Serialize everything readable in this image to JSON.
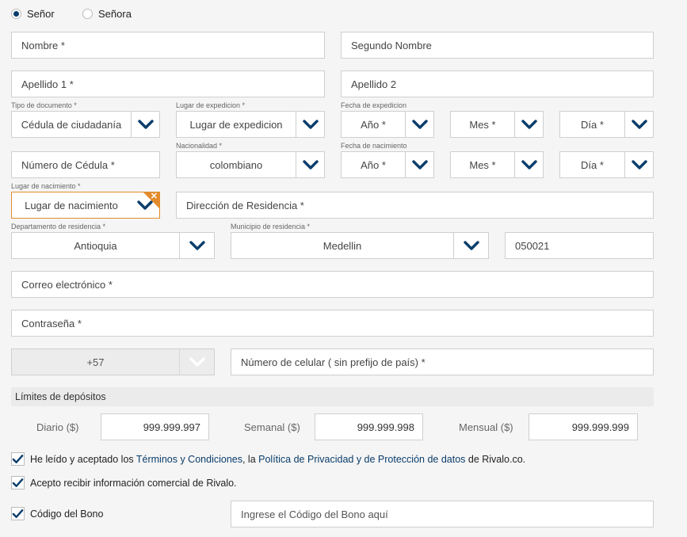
{
  "title": {
    "mr": "Señor",
    "mrs": "Señora"
  },
  "fields": {
    "first_name": "Nombre *",
    "middle_name": "Segundo Nombre",
    "last_name1": "Apellido 1 *",
    "last_name2": "Apellido 2",
    "doc_number": "Número de Cédula *",
    "address": "Dirección de Residencia *",
    "postal_code": "050021",
    "email": "Correo electrónico *",
    "password": "Contraseña *",
    "phone": "Número de celular ( sin prefijo de país) *",
    "bonus_placeholder": "Ingrese el Código del Bono aquí"
  },
  "labels": {
    "doc_type": "Tipo de documento *",
    "issue_place": "Lugar de expedicion *",
    "issue_date": "Fecha de expedicion",
    "nationality": "Nacionalidad *",
    "birth_date": "Fecha de nacimiento",
    "birth_place": "Lugar de nacimiento *",
    "department": "Departamento de residencia *",
    "municipality": "Municipio de residencia *"
  },
  "selects": {
    "doc_type": "Cédula de ciudadanía",
    "issue_place": "Lugar de expedicion",
    "issue_year": "Año *",
    "issue_month": "Mes *",
    "issue_day": "Día *",
    "nationality": "colombiano",
    "birth_year": "Año *",
    "birth_month": "Mes *",
    "birth_day": "Día *",
    "birth_place": "Lugar de nacimiento",
    "department": "Antioquia",
    "municipality": "Medellin",
    "phone_prefix": "+57"
  },
  "limits": {
    "title": "Límites de depósitos",
    "daily_label": "Diario ($)",
    "daily_value": "999.999.997",
    "weekly_label": "Semanal ($)",
    "weekly_value": "999.999.998",
    "monthly_label": "Mensual ($)",
    "monthly_value": "999.999.999"
  },
  "checks": {
    "terms_prefix": "He leído y aceptado los ",
    "terms_link": "Términos y Condiciones",
    "terms_mid": ", la ",
    "privacy_link": "Política de Privacidad y de Protección de datos",
    "terms_suffix": " de Rivalo.co.",
    "marketing": "Acepto recibir información comercial de Rivalo.",
    "bonus": "Código del Bono"
  },
  "colors": {
    "accent": "#0a3d6b",
    "error": "#e38b2c"
  }
}
